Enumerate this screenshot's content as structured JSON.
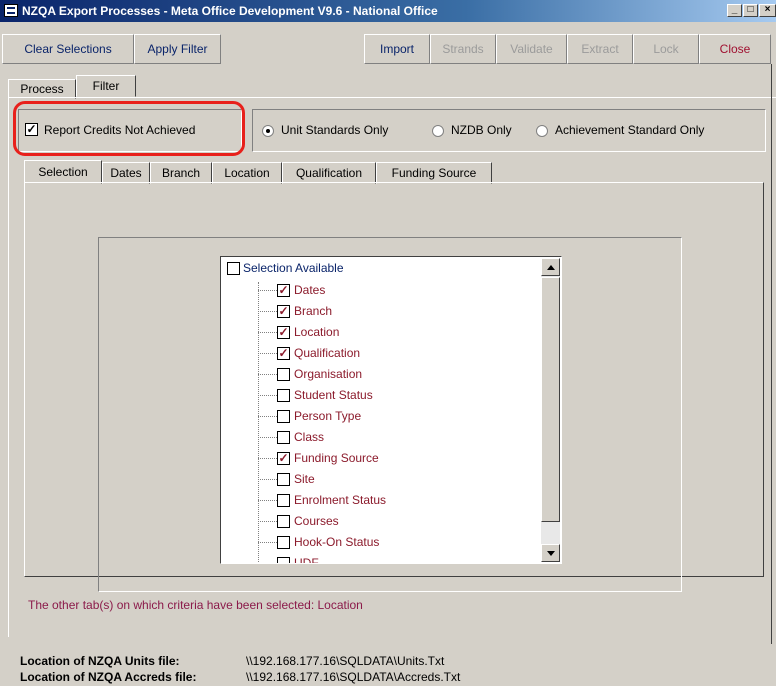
{
  "window": {
    "title": "NZQA Export Processes - Meta Office Development V9.6 - National Office"
  },
  "window_controls": {
    "minimize": "_",
    "maximize": "□",
    "close": "×"
  },
  "toolbar": {
    "clear_selections": "Clear Selections",
    "apply_filter": "Apply Filter",
    "import": "Import",
    "strands": "Strands",
    "validate": "Validate",
    "extract": "Extract",
    "lock": "Lock",
    "close": "Close"
  },
  "main_tabs": [
    {
      "label": "Process"
    },
    {
      "label": "Filter"
    }
  ],
  "options": {
    "report_credits_not_achieved": {
      "label": "Report Credits Not Achieved",
      "checked": true
    },
    "standard_type": {
      "selected": "Unit Standards Only",
      "choices": [
        "Unit Standards Only",
        "NZDB Only",
        "Achievement Standard Only"
      ]
    }
  },
  "sub_tabs": [
    {
      "label": "Selection"
    },
    {
      "label": "Dates"
    },
    {
      "label": "Branch"
    },
    {
      "label": "Location"
    },
    {
      "label": "Qualification"
    },
    {
      "label": "Funding Source"
    }
  ],
  "tree": {
    "root": {
      "label": "Selection Available",
      "checked": false
    },
    "items": [
      {
        "label": "Dates",
        "checked": true
      },
      {
        "label": "Branch",
        "checked": true
      },
      {
        "label": "Location",
        "checked": true
      },
      {
        "label": "Qualification",
        "checked": true
      },
      {
        "label": "Organisation",
        "checked": false
      },
      {
        "label": "Student Status",
        "checked": false
      },
      {
        "label": "Person Type",
        "checked": false
      },
      {
        "label": "Class",
        "checked": false
      },
      {
        "label": "Funding Source",
        "checked": true
      },
      {
        "label": "Site",
        "checked": false
      },
      {
        "label": "Enrolment Status",
        "checked": false
      },
      {
        "label": "Courses",
        "checked": false
      },
      {
        "label": "Hook-On Status",
        "checked": false
      },
      {
        "label": "UDF",
        "checked": false
      }
    ]
  },
  "info_text": "The other tab(s) on which criteria have been selected: Location",
  "files": {
    "units_label": "Location of NZQA Units file:",
    "units_path": "\\\\192.168.177.16\\SQLDATA\\Units.Txt",
    "accreds_label": "Location of NZQA Accreds file:",
    "accreds_path": "\\\\192.168.177.16\\SQLDATA\\Accreds.Txt"
  },
  "colors": {
    "highlight_border": "#e8201b",
    "tree_text": "#8b1a2b",
    "button_text": "#0a246a",
    "close_text": "#a01030"
  }
}
